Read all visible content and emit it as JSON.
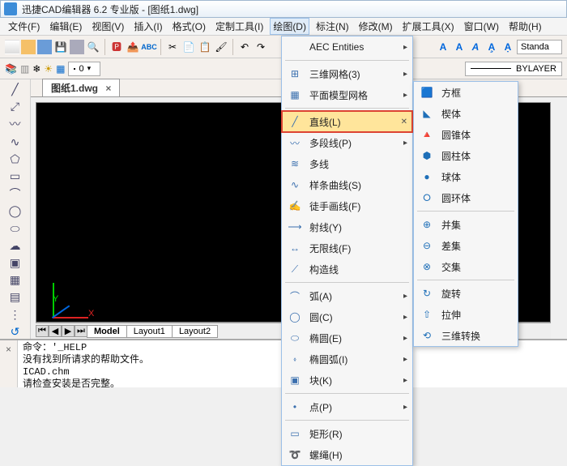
{
  "title": "迅捷CAD编辑器 6.2 专业版 - [图纸1.dwg]",
  "menus": [
    "文件(F)",
    "编辑(E)",
    "视图(V)",
    "插入(I)",
    "格式(O)",
    "定制工具(I)",
    "绘图(D)",
    "标注(N)",
    "修改(M)",
    "扩展工具(X)",
    "窗口(W)",
    "帮助(H)"
  ],
  "style_combo": "Standa",
  "layer_row": {
    "zero": "0",
    "bylayer": "BYLAYER"
  },
  "doc_tab": "图纸1.dwg",
  "axis": {
    "y": "Y",
    "x": "X"
  },
  "sheet_tabs": {
    "model": "Model",
    "l1": "Layout1",
    "l2": "Layout2"
  },
  "cmd": {
    "l1": "命令：'_HELP",
    "l2": "没有找到所请求的帮助文件。",
    "l3": "ICAD.chm",
    "l4": "请检查安装是否完整。"
  },
  "draw_menu": [
    {
      "id": "aec",
      "label": "AEC Entities",
      "arrow": true
    },
    {
      "sep": true
    },
    {
      "id": "mesh3d",
      "label": "三维网格(3)",
      "arrow": true
    },
    {
      "id": "pmesh",
      "label": "平面模型网格",
      "arrow": true
    },
    {
      "sep": true
    },
    {
      "id": "line",
      "label": "直线(L)",
      "highlight": true
    },
    {
      "id": "pline",
      "label": "多段线(P)",
      "arrow": true
    },
    {
      "id": "mline",
      "label": "多线"
    },
    {
      "id": "spline",
      "label": "样条曲线(S)"
    },
    {
      "id": "freehand",
      "label": "徒手画线(F)"
    },
    {
      "id": "ray",
      "label": "射线(Y)"
    },
    {
      "id": "xline",
      "label": "无限线(F)"
    },
    {
      "id": "conline",
      "label": "构造线"
    },
    {
      "sep": true
    },
    {
      "id": "arc",
      "label": "弧(A)",
      "arrow": true
    },
    {
      "id": "circle",
      "label": "圆(C)",
      "arrow": true
    },
    {
      "id": "ellipse",
      "label": "椭圆(E)",
      "arrow": true
    },
    {
      "id": "ellarc",
      "label": "椭圆弧(I)",
      "arrow": true
    },
    {
      "id": "block",
      "label": "块(K)",
      "arrow": true
    },
    {
      "sep": true
    },
    {
      "id": "point",
      "label": "点(P)",
      "arrow": true
    },
    {
      "sep": true
    },
    {
      "id": "rect",
      "label": "矩形(R)"
    },
    {
      "id": "spiral",
      "label": "螺绳(H)"
    }
  ],
  "submenu": [
    {
      "id": "box",
      "label": "方框"
    },
    {
      "id": "wedge",
      "label": "楔体"
    },
    {
      "id": "cone",
      "label": "圆锥体"
    },
    {
      "id": "cyl",
      "label": "圆柱体"
    },
    {
      "id": "sphere",
      "label": "球体"
    },
    {
      "id": "torus",
      "label": "圆环体"
    },
    {
      "sep": true
    },
    {
      "id": "union",
      "label": "并集"
    },
    {
      "id": "subtract",
      "label": "差集"
    },
    {
      "id": "intersect",
      "label": "交集"
    },
    {
      "sep": true
    },
    {
      "id": "rotate3d",
      "label": "旋转"
    },
    {
      "id": "extrude",
      "label": "拉伸"
    },
    {
      "id": "convert3d",
      "label": "三维转换"
    }
  ]
}
